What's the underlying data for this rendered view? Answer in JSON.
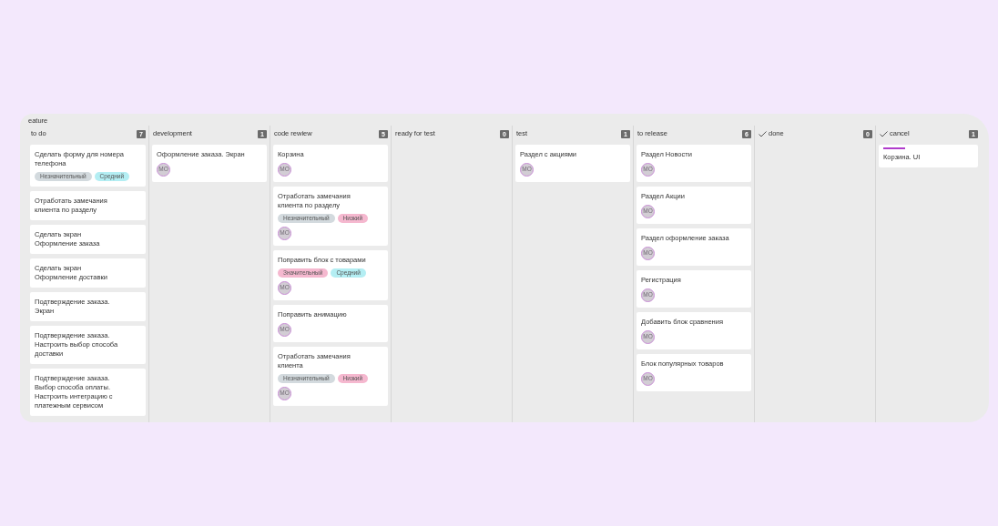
{
  "board": {
    "title": "eature",
    "columns": [
      {
        "name": "to do",
        "count": "7",
        "checkmark": false,
        "cards": [
          {
            "title": "Сделать форму для номера телефона",
            "tags": [
              {
                "label": "Незначительный",
                "color": "#d3dade"
              },
              {
                "label": "Средний",
                "color": "#b4eef3"
              }
            ]
          },
          {
            "title": "Отработать замечания клиента по разделу"
          },
          {
            "title": "Сделать экран Оформление заказа"
          },
          {
            "title": "Сделать экран Оформление доставки"
          },
          {
            "title": "Подтверждение заказа. Экран"
          },
          {
            "title": "Подтверждение заказа. Настроить выбор способа доставки"
          },
          {
            "title": "Подтверждение заказа. Выбор способа оплаты. Настроить интеграцию с платежным сервисом"
          }
        ]
      },
      {
        "name": "development",
        "count": "1",
        "checkmark": false,
        "cards": [
          {
            "title": "Оформление заказа. Экран",
            "avatar": "МО"
          }
        ]
      },
      {
        "name": "code rewiew",
        "count": "5",
        "checkmark": false,
        "cards": [
          {
            "title": "Корзина",
            "avatar": "МО"
          },
          {
            "title": "Отработать замечания клиента по разделу",
            "tags": [
              {
                "label": "Незначительный",
                "color": "#d3dade"
              },
              {
                "label": "Низкий",
                "color": "#f5b8cf"
              }
            ],
            "avatar": "МО"
          },
          {
            "title": "Поправить блок с товарами",
            "tags": [
              {
                "label": "Значительный",
                "color": "#f5b8cf"
              },
              {
                "label": "Средний",
                "color": "#b4eef3"
              }
            ],
            "avatar": "МО"
          },
          {
            "title": "Поправить анимацию",
            "avatar": "МО"
          },
          {
            "title": "Отработать замечания клиента",
            "tags": [
              {
                "label": "Незначительный",
                "color": "#d3dade"
              },
              {
                "label": "Низкий",
                "color": "#f5b8cf"
              }
            ],
            "avatar": "МО"
          }
        ]
      },
      {
        "name": "ready for test",
        "count": "0",
        "checkmark": false
      },
      {
        "name": "test",
        "count": "1",
        "checkmark": false,
        "cards": [
          {
            "title": "Раздел с акциями",
            "avatar": "МО"
          }
        ]
      },
      {
        "name": "to release",
        "count": "6",
        "checkmark": false,
        "cards": [
          {
            "title": "Раздел Новости",
            "avatar": "МО"
          },
          {
            "title": "Раздел Акции",
            "avatar": "МО"
          },
          {
            "title": "Раздел оформление заказа",
            "avatar": "МО"
          },
          {
            "title": "Регистрация",
            "avatar": "МО"
          },
          {
            "title": "Добавить блок сравнения",
            "avatar": "МО"
          },
          {
            "title": "Блок популярных товаров",
            "avatar": "МО"
          }
        ]
      },
      {
        "name": "done",
        "count": "0",
        "checkmark": true
      },
      {
        "name": "cancel",
        "count": "1",
        "checkmark": true,
        "cards": [
          {
            "title": "Корзина. UI",
            "color": "#b03ccc"
          }
        ]
      }
    ]
  }
}
